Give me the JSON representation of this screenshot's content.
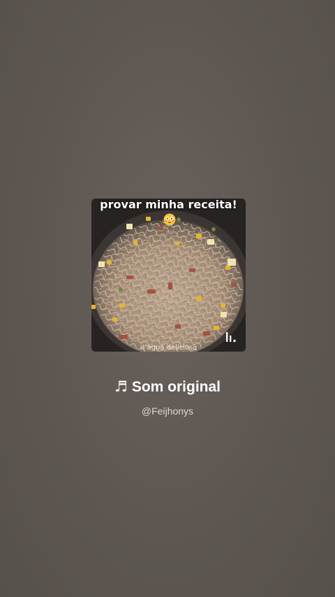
{
  "cover": {
    "caption": "provar minha receita!",
    "bottom_text": "d’água deliciosa",
    "emoji_icon": "flushed-face-icon",
    "logo_icon": "kwai-logo-icon"
  },
  "track": {
    "note_icon": "♬",
    "title": "Som original",
    "author": "@Feijhonys"
  },
  "colors": {
    "background": "#5e5751",
    "title_text": "#ffffff",
    "author_text": "#dcd8d4"
  }
}
